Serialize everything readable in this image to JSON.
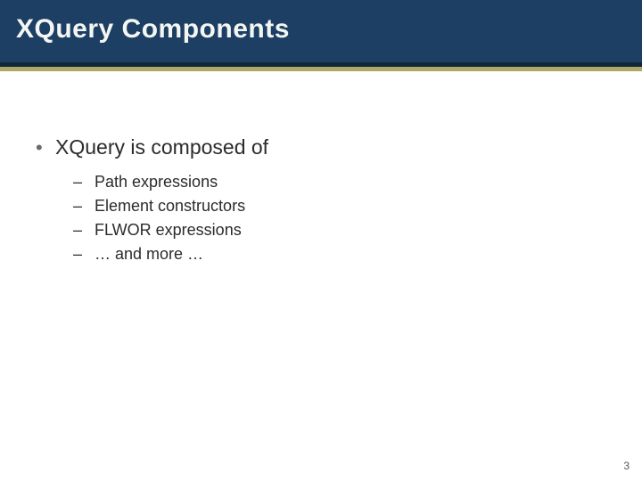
{
  "title": "XQuery Components",
  "bullet": {
    "marker": "•",
    "text": "XQuery is composed of",
    "sub_marker": "–",
    "items": [
      "Path expressions",
      "Element constructors",
      "FLWOR expressions",
      "… and more …"
    ]
  },
  "page_number": "3"
}
